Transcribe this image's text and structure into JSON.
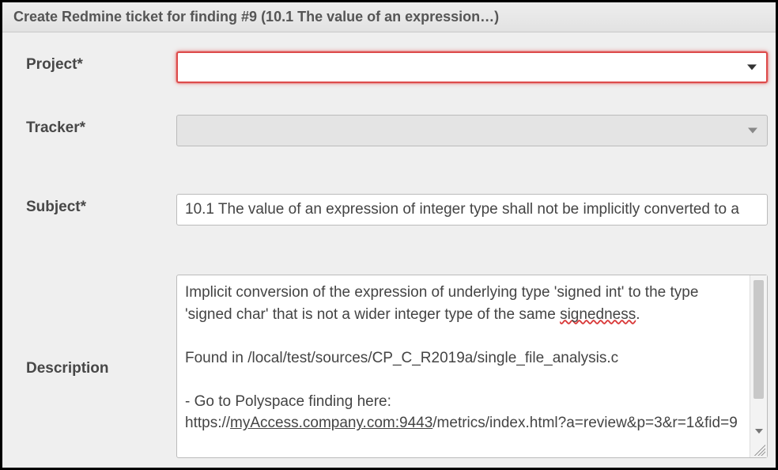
{
  "dialog": {
    "title": "Create Redmine ticket for finding #9 (10.1 The value of an expression…)"
  },
  "labels": {
    "project": "Project*",
    "tracker": "Tracker*",
    "subject": "Subject*",
    "description": "Description"
  },
  "fields": {
    "project": {
      "value": "",
      "placeholder": ""
    },
    "tracker": {
      "value": "",
      "placeholder": ""
    },
    "subject": {
      "value": "10.1 The value of an expression of integer type shall not be implicitly converted to a"
    },
    "description": {
      "line1": "Implicit conversion of the expression of underlying type 'signed int' to the type 'signed char' that is not a wider integer type of the same ",
      "spellerr": "signedness",
      "line1_tail": ".",
      "blank": "",
      "line2": "Found in /local/test/sources/CP_C_R2019a/single_file_analysis.c",
      "line3": "- Go to Polyspace finding here:",
      "url_prefix": "https://",
      "url_host": "myAccess.company.com:9443",
      "url_path": "/metrics/index.html?a=review&p=3&r=1&fid=9"
    }
  }
}
